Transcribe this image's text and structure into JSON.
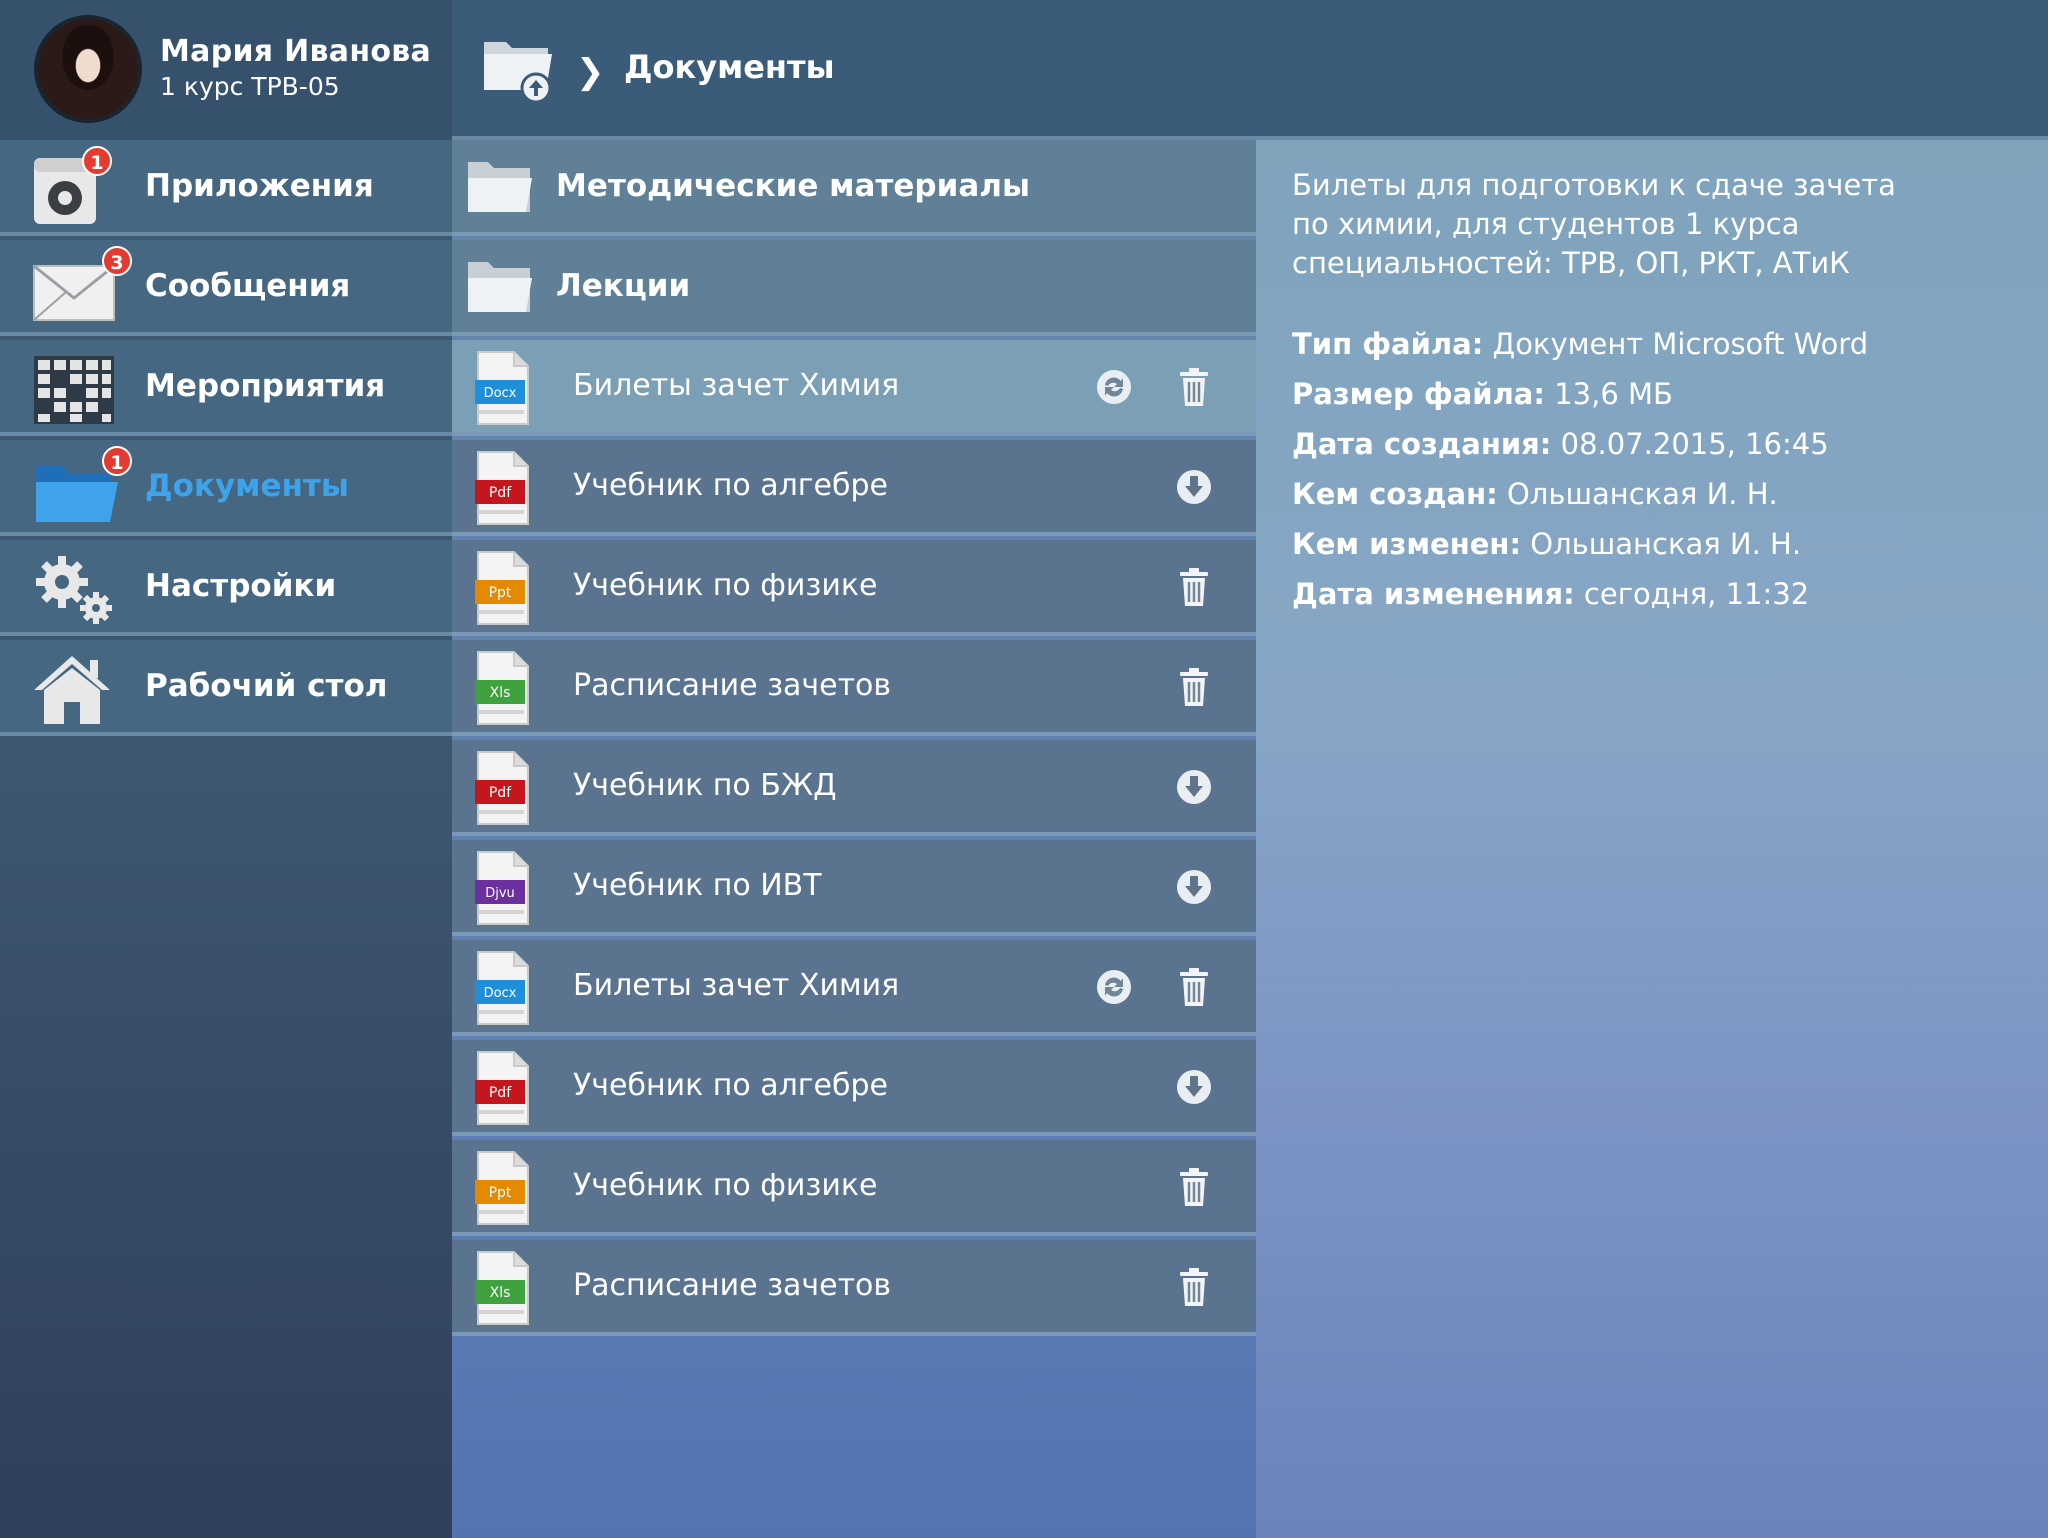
{
  "user": {
    "name": "Мария Иванова",
    "group": "1 курс ТРВ-05"
  },
  "sidebar": {
    "items": [
      {
        "label": "Приложения",
        "icon": "camera-app-icon",
        "badge": "1"
      },
      {
        "label": "Сообщения",
        "icon": "envelope-icon",
        "badge": "3"
      },
      {
        "label": "Мероприятия",
        "icon": "calendar-grid-icon",
        "badge": ""
      },
      {
        "label": "Документы",
        "icon": "folder-icon",
        "badge": "1",
        "active": true
      },
      {
        "label": "Настройки",
        "icon": "gears-icon",
        "badge": ""
      },
      {
        "label": "Рабочий стол",
        "icon": "home-icon",
        "badge": ""
      }
    ]
  },
  "header": {
    "breadcrumb": "Документы"
  },
  "folders": [
    {
      "label": "Методические материалы"
    },
    {
      "label": "Лекции"
    }
  ],
  "files": [
    {
      "name": "Билеты зачет Химия",
      "type": "Docx",
      "actions": [
        "sync",
        "delete"
      ],
      "selected": true
    },
    {
      "name": "Учебник по алгебре",
      "type": "Pdf",
      "actions": [
        "download"
      ]
    },
    {
      "name": "Учебник по физике",
      "type": "Ppt",
      "actions": [
        "delete"
      ]
    },
    {
      "name": "Расписание зачетов",
      "type": "Xls",
      "actions": [
        "delete"
      ]
    },
    {
      "name": "Учебник по БЖД",
      "type": "Pdf",
      "actions": [
        "download"
      ]
    },
    {
      "name": "Учебник по ИВТ",
      "type": "Djvu",
      "actions": [
        "download"
      ]
    },
    {
      "name": "Билеты зачет Химия",
      "type": "Docx",
      "actions": [
        "sync",
        "delete"
      ]
    },
    {
      "name": "Учебник по алгебре",
      "type": "Pdf",
      "actions": [
        "download"
      ]
    },
    {
      "name": "Учебник по физике",
      "type": "Ppt",
      "actions": [
        "delete"
      ]
    },
    {
      "name": "Расписание зачетов",
      "type": "Xls",
      "actions": [
        "delete"
      ]
    }
  ],
  "file_type_colors": {
    "Docx": "#1e8fd8",
    "Pdf": "#c4161c",
    "Ppt": "#e58a00",
    "Xls": "#3fa23f",
    "Djvu": "#6c2f9e"
  },
  "details": {
    "description": "Билеты для подготовки к сдаче зачета по химии, для студентов 1 курса специальностей: ТРВ, ОП, РКТ, АТиК",
    "properties": [
      {
        "key": "Тип файла:",
        "value": "Документ Microsoft Word"
      },
      {
        "key": "Размер файла:",
        "value": "13,6 МБ"
      },
      {
        "key": "Дата создания:",
        "value": "08.07.2015, 16:45"
      },
      {
        "key": "Кем создан:",
        "value": "Ольшанская И. Н."
      },
      {
        "key": "Кем изменен:",
        "value": "Ольшанская И. Н."
      },
      {
        "key": "Дата изменения:",
        "value": "сегодня, 11:32"
      }
    ]
  }
}
